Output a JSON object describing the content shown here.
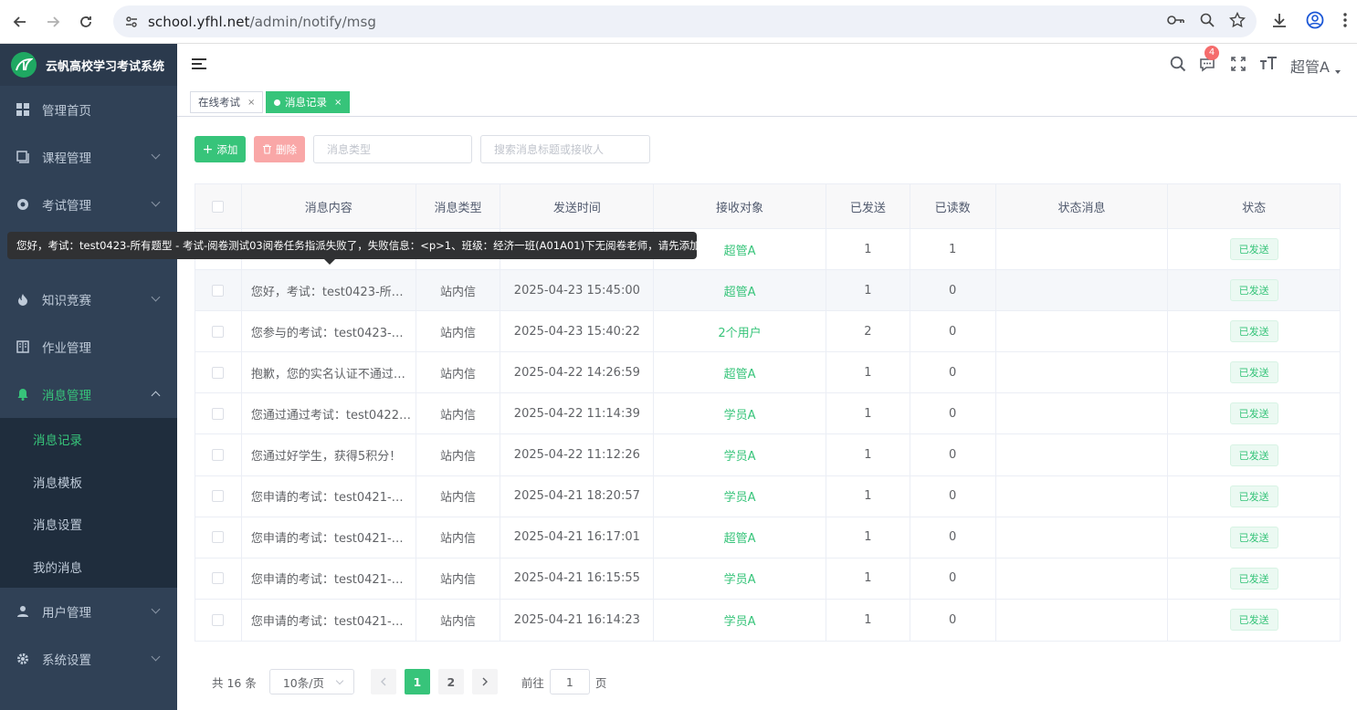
{
  "browser": {
    "url_host": "school.yfhl.net",
    "url_path": "/admin/notify/msg"
  },
  "sidebar": {
    "app_title": "云帆高校学习考试系统",
    "items": [
      {
        "label": "管理首页",
        "icon": "dashboard-icon"
      },
      {
        "label": "课程管理",
        "icon": "book-icon"
      },
      {
        "label": "考试管理",
        "icon": "exam-icon"
      },
      {
        "label": "知识竞赛",
        "icon": "fire-icon"
      },
      {
        "label": "作业管理",
        "icon": "homework-icon"
      },
      {
        "label": "消息管理",
        "icon": "bell-icon"
      },
      {
        "label": "用户管理",
        "icon": "user-icon"
      },
      {
        "label": "系统设置",
        "icon": "gear-icon"
      }
    ],
    "submenu": [
      "消息记录",
      "消息模板",
      "消息设置",
      "我的消息"
    ]
  },
  "header": {
    "notification_count": "4",
    "user_name": "超管A"
  },
  "tags": {
    "tag1": "在线考试",
    "tag2": "消息记录"
  },
  "toolbar": {
    "add_label": "添加",
    "delete_label": "删除",
    "type_placeholder": "消息类型",
    "search_placeholder": "搜索消息标题或接收人"
  },
  "table": {
    "headers": [
      "消息内容",
      "消息类型",
      "发送时间",
      "接收对象",
      "已发送",
      "已读数",
      "状态消息",
      "状态"
    ],
    "rows": [
      {
        "content": "",
        "type": "",
        "time": "",
        "receiver": "超管A",
        "sent": "1",
        "read": "1",
        "status_msg": "",
        "status": "已发送"
      },
      {
        "content": "您好，考试：test0423-所…",
        "type": "站内信",
        "time": "2025-04-23 15:45:00",
        "receiver": "超管A",
        "sent": "1",
        "read": "0",
        "status_msg": "",
        "status": "已发送"
      },
      {
        "content": "您参与的考试：test0423-…",
        "type": "站内信",
        "time": "2025-04-23 15:40:22",
        "receiver": "2个用户",
        "sent": "2",
        "read": "0",
        "status_msg": "",
        "status": "已发送"
      },
      {
        "content": "抱歉，您的实名认证不通过…",
        "type": "站内信",
        "time": "2025-04-22 14:26:59",
        "receiver": "超管A",
        "sent": "1",
        "read": "0",
        "status_msg": "",
        "status": "已发送"
      },
      {
        "content": "您通过通过考试：test0422…",
        "type": "站内信",
        "time": "2025-04-22 11:14:39",
        "receiver": "学员A",
        "sent": "1",
        "read": "0",
        "status_msg": "",
        "status": "已发送"
      },
      {
        "content": " 您通过好学生，获得5积分！",
        "type": "站内信",
        "time": "2025-04-22 11:12:26",
        "receiver": "学员A",
        "sent": "1",
        "read": "0",
        "status_msg": "",
        "status": "已发送"
      },
      {
        "content": "您申请的考试：test0421-…",
        "type": "站内信",
        "time": "2025-04-21 18:20:57",
        "receiver": "学员A",
        "sent": "1",
        "read": "0",
        "status_msg": "",
        "status": "已发送"
      },
      {
        "content": "您申请的考试：test0421-…",
        "type": "站内信",
        "time": "2025-04-21 16:17:01",
        "receiver": "超管A",
        "sent": "1",
        "read": "0",
        "status_msg": "",
        "status": "已发送"
      },
      {
        "content": "您申请的考试：test0421-…",
        "type": "站内信",
        "time": "2025-04-21 16:15:55",
        "receiver": "学员A",
        "sent": "1",
        "read": "0",
        "status_msg": "",
        "status": "已发送"
      },
      {
        "content": "您申请的考试：test0421-…",
        "type": "站内信",
        "time": "2025-04-21 16:14:23",
        "receiver": "学员A",
        "sent": "1",
        "read": "0",
        "status_msg": "",
        "status": "已发送"
      }
    ]
  },
  "tooltip": {
    "text": "您好，考试：test0423-所有题型 - 考试-阅卷测试03阅卷任务指派失败了，失败信息：<p>1、班级：经济一班(A01A01)下无阅卷老师，请先添加！</p>"
  },
  "pagination": {
    "total": "共 16 条",
    "page_size": "10条/页",
    "pages": [
      "1",
      "2"
    ],
    "goto_label": "前往",
    "goto_value": "1",
    "page_unit": "页"
  },
  "colors": {
    "accent": "#37c47a",
    "sidebar_bg": "#304156",
    "danger": "#f56c6c"
  }
}
